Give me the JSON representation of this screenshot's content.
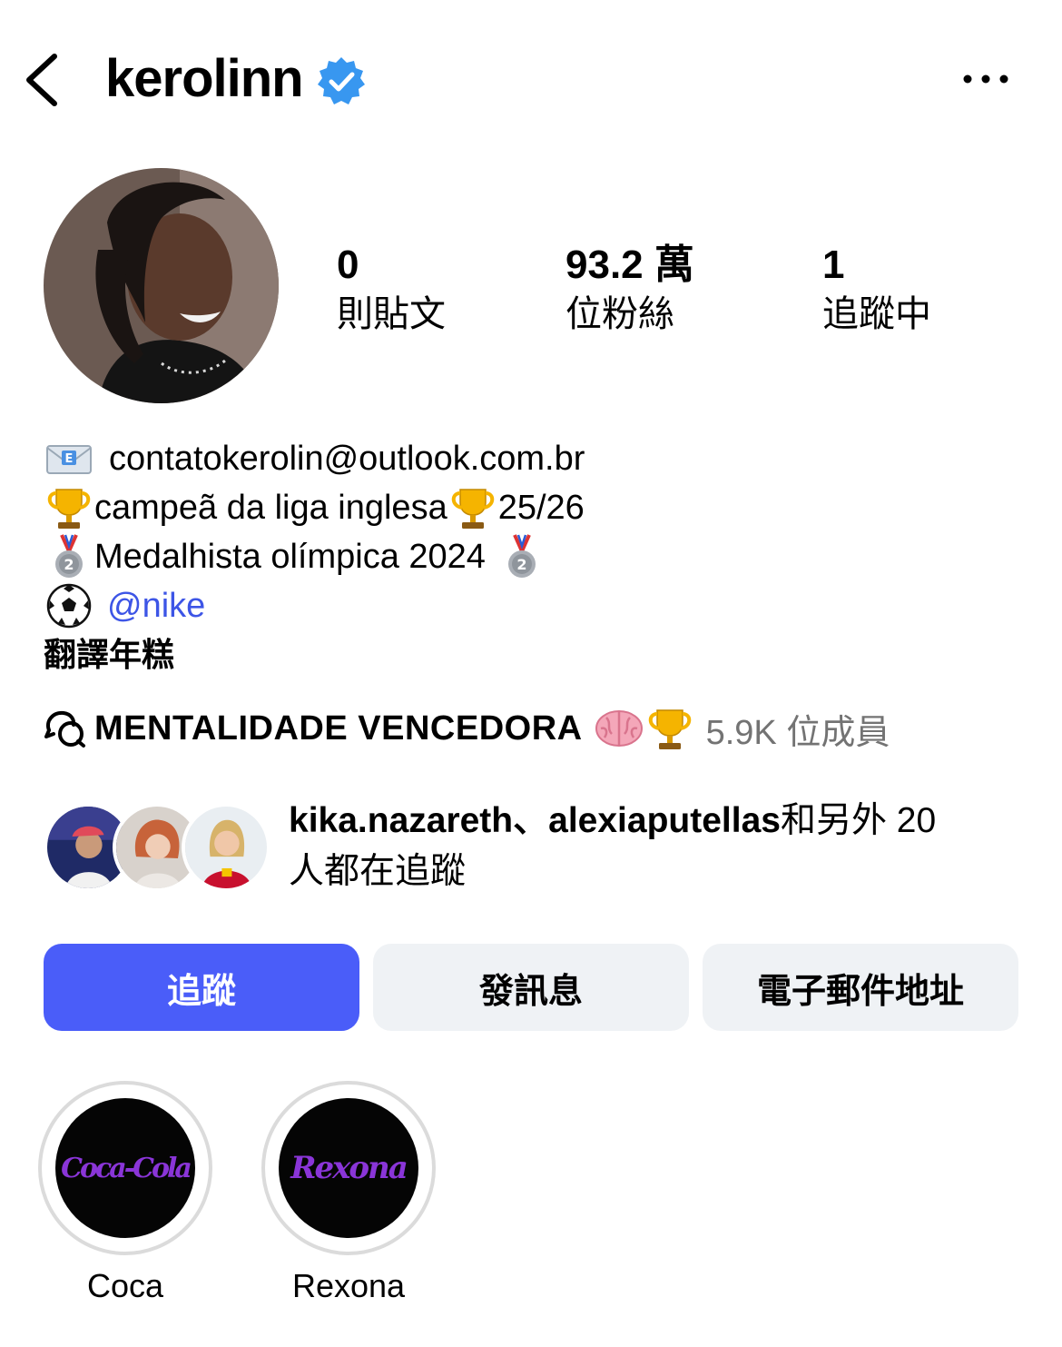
{
  "header": {
    "username": "kerolinn",
    "back_icon": "chevron-left-icon",
    "verified_icon": "verified-badge-icon",
    "more_icon": "more-horizontal-icon",
    "verified_color": "#3897f0"
  },
  "stats": [
    {
      "value": "0",
      "label": "則貼文"
    },
    {
      "value": "93.2 萬",
      "label": "位粉絲"
    },
    {
      "value": "1",
      "label": "追蹤中"
    }
  ],
  "bio": {
    "email_line": "contatokerolin@outlook.com.br",
    "title_line_a": "campeã da liga inglesa",
    "title_line_b": "25/26",
    "medal_line": "Medalhista olímpica 2024",
    "nike_mention": "@nike",
    "translate_label": "翻譯年糕"
  },
  "channel": {
    "icon": "chat-bubbles-icon",
    "title": "MENTALIDADE VENCEDORA",
    "members": "5.9K 位成員"
  },
  "followed_by": {
    "name_1": "kika.nazareth",
    "separator": "、",
    "name_2": "alexiaputellas",
    "rest_line_1": "和另外 20",
    "rest_line_2": "人都在追蹤"
  },
  "actions": {
    "follow": "追蹤",
    "message": "發訊息",
    "email": "電子郵件地址"
  },
  "highlights": [
    {
      "cover_text": "Coca-Cola",
      "label": "Coca"
    },
    {
      "cover_text": "Rexona",
      "label": "Rexona"
    }
  ],
  "colors": {
    "accent": "#4a5df9",
    "link": "#3d55e6",
    "secondary_button": "#eff2f5",
    "muted_text": "#737373",
    "highlight_logo": "#8a35d8"
  }
}
